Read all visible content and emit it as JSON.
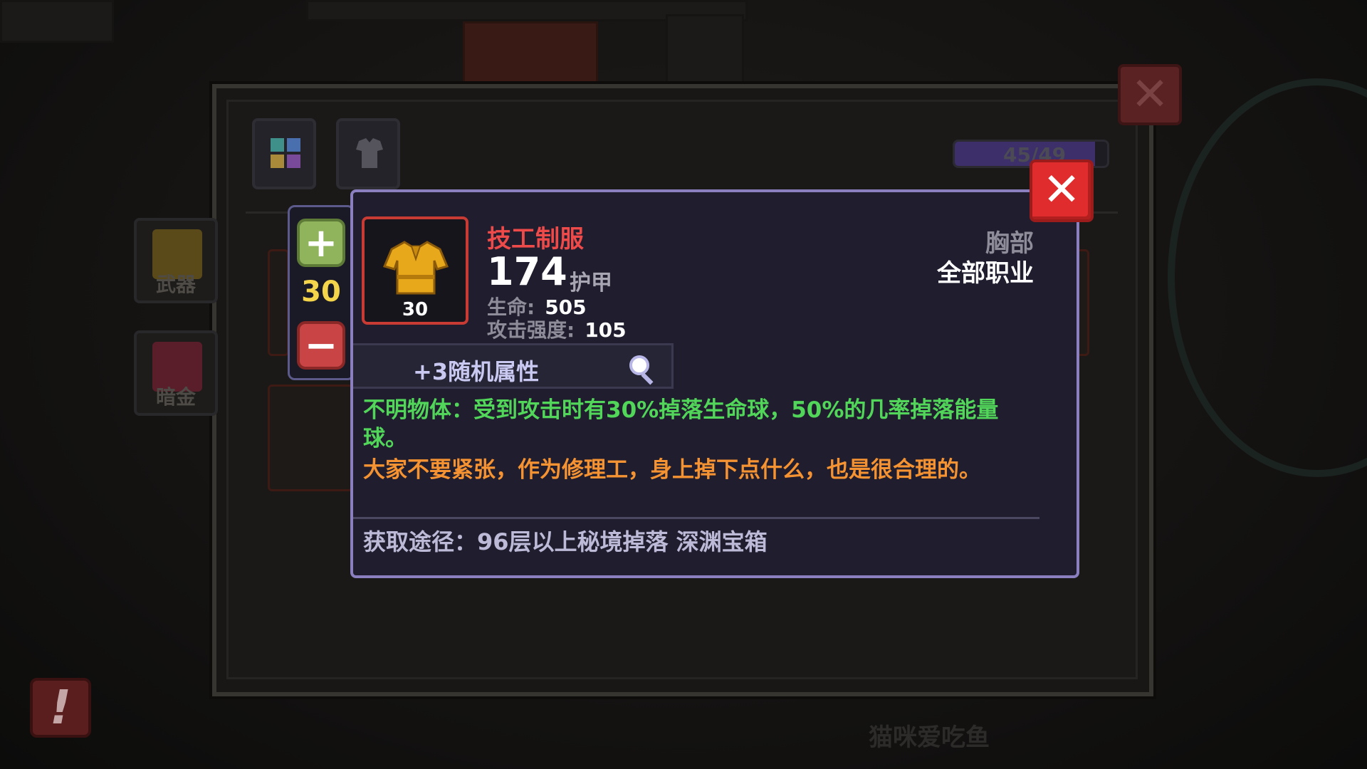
{
  "inventory": {
    "capacity_text": "45/49",
    "capacity_fraction": 0.92,
    "side_slots": [
      {
        "label": "武器",
        "icon": "weapon-slot-icon"
      },
      {
        "label": "暗金",
        "icon": "dark-gold-slot-icon"
      }
    ],
    "tabs": [
      {
        "icon": "grid-tab-icon"
      },
      {
        "icon": "armor-tab-icon"
      }
    ],
    "close_icon": "close-icon",
    "alert_icon": "exclamation-icon",
    "alert_symbol": "!",
    "close_symbol": "✕"
  },
  "quantity": {
    "plus_symbol": "+",
    "value": "30",
    "minus_symbol": "−"
  },
  "item": {
    "name": "技工制服",
    "level": "30",
    "armor_value": "174",
    "armor_label": "护甲",
    "stats": [
      {
        "label": "生命:",
        "value": "505"
      },
      {
        "label": "攻击强度:",
        "value": "105"
      }
    ],
    "slot_type": "胸部",
    "class_restriction": "全部职业",
    "random_attributes": "+3随机属性",
    "effect_text": "不明物体：受到攻击时有30%掉落生命球，50%的几率掉落能量球。",
    "flavor_text": "大家不要紧张，作为修理工，身上掉下点什么，也是很合理的。",
    "source_text": "获取途径：96层以上秘境掉落 深渊宝箱",
    "icon": "uniform-icon",
    "close_symbol": "✕"
  },
  "watermark": "猫咪爱吃鱼",
  "colors": {
    "item_name": "#ee4a4a",
    "effect": "#52d65a",
    "flavor": "#f59332",
    "quantity": "#f4d44a",
    "close_button": "#e02c2c",
    "card_border": "#8b7fbf"
  }
}
